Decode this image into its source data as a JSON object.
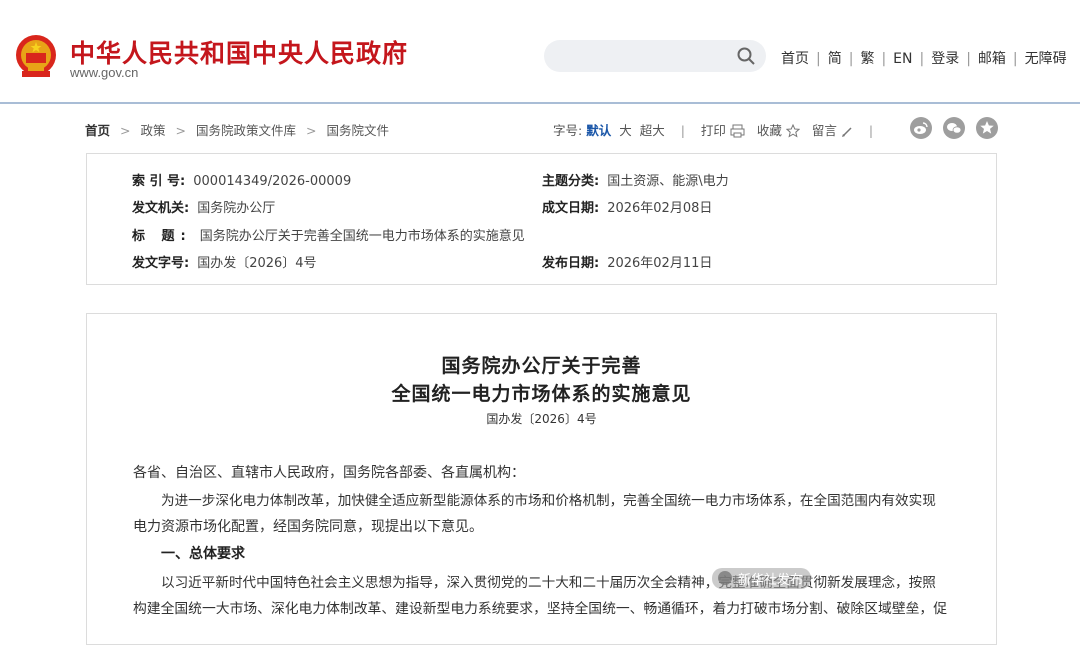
{
  "header": {
    "site_title": "中华人民共和国中央人民政府",
    "site_url": "www.gov.cn",
    "search_placeholder": "",
    "top_links": [
      "首页",
      "简",
      "繁",
      "EN",
      "登录",
      "邮箱",
      "无障碍"
    ]
  },
  "breadcrumb": [
    "首页",
    "政策",
    "国务院政策文件库",
    "国务院文件"
  ],
  "tools": {
    "font_size_label": "字号:",
    "font_default": "默认",
    "font_large": "大",
    "font_xlarge": "超大",
    "print": "打印",
    "favorite": "收藏",
    "comment": "留言"
  },
  "social_icons": [
    "weibo-icon",
    "wechat-icon",
    "star-icon"
  ],
  "meta": {
    "index_label": "索 引 号:",
    "index_value": "000014349/2026-00009",
    "category_label": "主题分类:",
    "category_value": "国土资源、能源\\电力",
    "issuer_label": "发文机关:",
    "issuer_value": "国务院办公厅",
    "written_label": "成文日期:",
    "written_value": "2026年02月08日",
    "title_label": "标 题:",
    "title_value": "国务院办公厅关于完善全国统一电力市场体系的实施意见",
    "docno_label": "发文字号:",
    "docno_value": "国办发〔2026〕4号",
    "publish_label": "发布日期:",
    "publish_value": "2026年02月11日"
  },
  "article": {
    "title_line1": "国务院办公厅关于完善",
    "title_line2": "全国统一电力市场体系的实施意见",
    "doc_number": "国办发〔2026〕4号",
    "salutation": "各省、自治区、直辖市人民政府，国务院各部委、各直属机构：",
    "para1_line1": "为进一步深化电力体制改革，加快健全适应新型能源体系的市场和价格机制，完善全国统一电力市场体系，在全国范围内有效实现",
    "para1_line2": "电力资源市场化配置，经国务院同意，现提出以下意见。",
    "section1": "一、总体要求",
    "para2_line1": "以习近平新时代中国特色社会主义思想为指导，深入贯彻党的二十大和二十届历次全会精神，完整准确全面贯彻新发展理念，按照",
    "para2_line2": "构建全国统一大市场、深化电力体制改革、建设新型电力系统要求，坚持全国统一、畅通循环，着力打破市场分割、破除区域壁垒，促"
  },
  "watermark": "新华社发布"
}
